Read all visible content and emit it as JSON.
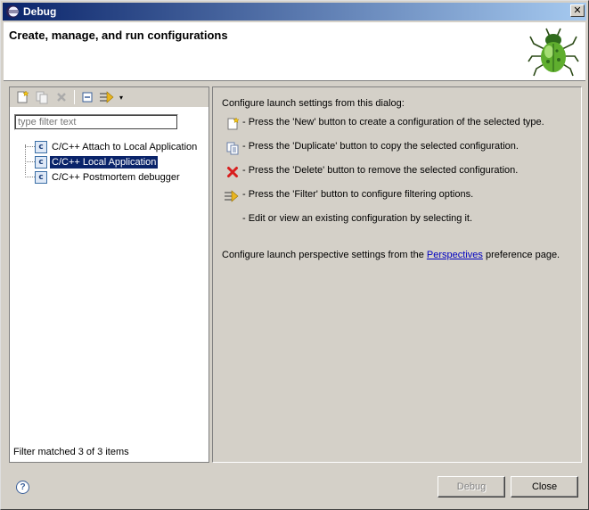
{
  "window": {
    "title": "Debug",
    "close_label": "✕"
  },
  "header": {
    "title": "Create, manage, and run configurations",
    "icon": "debug-bug-icon"
  },
  "toolbar": {
    "items": [
      "new-config-icon",
      "duplicate-icon",
      "delete-icon",
      "collapse-all-icon",
      "filter-icon",
      "dropdown-arrow-icon"
    ],
    "dropdown_label": "▾"
  },
  "filter": {
    "placeholder": "type filter text",
    "value": "type filter text"
  },
  "tree": {
    "items": [
      {
        "label": "C/C++ Attach to Local Application",
        "icon_text": "c",
        "selected": false
      },
      {
        "label": "C/C++ Local Application",
        "icon_text": "c",
        "selected": true
      },
      {
        "label": "C/C++ Postmortem debugger",
        "icon_text": "c",
        "selected": false
      }
    ],
    "status": "Filter matched 3 of 3 items"
  },
  "info": {
    "intro": "Configure launch settings from this dialog:",
    "lines": [
      "- Press the 'New' button to create a configuration of the selected type.",
      "- Press the 'Duplicate' button to copy the selected configuration.",
      "- Press the 'Delete' button to remove the selected configuration.",
      "- Press the 'Filter' button to configure filtering options.",
      "- Edit or view an existing configuration by selecting it."
    ],
    "perspective_prefix": "Configure launch perspective settings from the ",
    "perspective_link": "Perspectives",
    "perspective_suffix": " preference page."
  },
  "footer": {
    "help_label": "?",
    "debug_label": "Debug",
    "close_label": "Close"
  },
  "colors": {
    "selection": "#0a246a",
    "titlebar_start": "#0a246a",
    "titlebar_end": "#a6caf0",
    "link": "#0000c0"
  }
}
